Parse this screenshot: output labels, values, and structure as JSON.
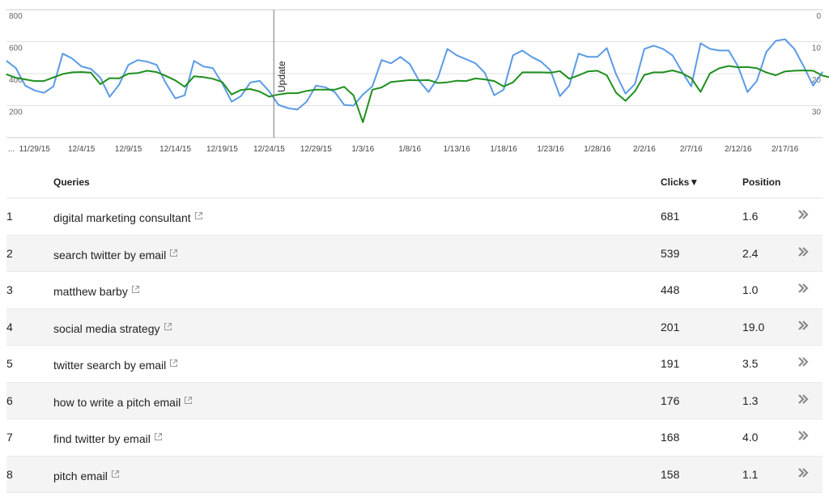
{
  "chart_data": {
    "type": "line",
    "x_tick_labels": [
      "...",
      "11/29/15",
      "12/4/15",
      "12/9/15",
      "12/14/15",
      "12/19/15",
      "12/24/15",
      "12/29/15",
      "1/3/16",
      "1/8/16",
      "1/13/16",
      "1/18/16",
      "1/23/16",
      "1/28/16",
      "2/2/16",
      "2/7/16",
      "2/12/16",
      "2/17/16"
    ],
    "y_left_ticks": [
      "800",
      "600",
      "400",
      "200"
    ],
    "y_right_ticks": [
      "0",
      "10",
      "20",
      "30"
    ],
    "ylim_left": [
      0,
      800
    ],
    "ylim_right": [
      40,
      0
    ],
    "annotation": "Update",
    "annotation_x": 28.5,
    "series": [
      {
        "axis": "left",
        "color": "#5b9be6",
        "values": [
          480,
          435,
          325,
          295,
          280,
          320,
          525,
          495,
          445,
          430,
          375,
          255,
          330,
          455,
          485,
          475,
          455,
          340,
          245,
          265,
          480,
          445,
          435,
          340,
          225,
          260,
          345,
          355,
          290,
          205,
          185,
          175,
          225,
          325,
          315,
          285,
          205,
          200,
          270,
          320,
          485,
          465,
          505,
          460,
          355,
          285,
          375,
          555,
          515,
          490,
          465,
          405,
          265,
          300,
          515,
          545,
          505,
          475,
          420,
          260,
          325,
          525,
          505,
          505,
          560,
          395,
          275,
          335,
          555,
          575,
          555,
          515,
          415,
          320,
          590,
          555,
          545,
          545,
          445,
          285,
          355,
          535,
          605,
          615,
          555,
          445,
          325,
          410
        ]
      },
      {
        "axis": "right",
        "color": "#1e8f1e",
        "values": [
          20.2,
          21.3,
          21.8,
          22.3,
          22.3,
          21.2,
          20.1,
          19.6,
          19.5,
          19.7,
          23.3,
          21.4,
          21.5,
          20.0,
          19.8,
          19.1,
          19.5,
          20.7,
          22.1,
          24.1,
          20.8,
          21.1,
          21.6,
          22.6,
          26.5,
          25.1,
          24.8,
          25.6,
          27.2,
          26.5,
          26.1,
          26.1,
          25.4,
          25.0,
          25.0,
          25.0,
          24.1,
          26.8,
          35.2,
          25.0,
          24.3,
          22.6,
          22.3,
          22.0,
          22.1,
          22.0,
          22.9,
          22.7,
          22.2,
          22.3,
          21.5,
          21.8,
          22.3,
          24.0,
          22.7,
          19.6,
          19.6,
          19.6,
          19.7,
          19.2,
          21.6,
          20.5,
          19.3,
          19.1,
          20.5,
          26.0,
          28.5,
          25.5,
          20.4,
          19.6,
          19.6,
          19.0,
          19.8,
          21.4,
          25.7,
          19.9,
          18.3,
          17.6,
          18.0,
          17.9,
          18.3,
          19.6,
          20.5,
          19.3,
          19.1,
          19.0,
          19.1,
          20.6,
          21.3
        ]
      }
    ]
  },
  "table": {
    "headers": {
      "queries": "Queries",
      "clicks": "Clicks▼",
      "position": "Position"
    },
    "rows": [
      {
        "idx": "1",
        "query": "digital marketing consultant",
        "clicks": "681",
        "position": "1.6"
      },
      {
        "idx": "2",
        "query": "search twitter by email",
        "clicks": "539",
        "position": "2.4"
      },
      {
        "idx": "3",
        "query": "matthew barby",
        "clicks": "448",
        "position": "1.0"
      },
      {
        "idx": "4",
        "query": "social media strategy",
        "clicks": "201",
        "position": "19.0"
      },
      {
        "idx": "5",
        "query": "twitter search by email",
        "clicks": "191",
        "position": "3.5"
      },
      {
        "idx": "6",
        "query": "how to write a pitch email",
        "clicks": "176",
        "position": "1.3"
      },
      {
        "idx": "7",
        "query": "find twitter by email",
        "clicks": "168",
        "position": "4.0"
      },
      {
        "idx": "8",
        "query": "pitch email",
        "clicks": "158",
        "position": "1.1"
      }
    ],
    "icons": {
      "external": "external-link-icon",
      "action": "double-chevron-right-icon"
    },
    "colors": {
      "row_alt": "#f4f4f4",
      "icon": "#999999"
    }
  }
}
